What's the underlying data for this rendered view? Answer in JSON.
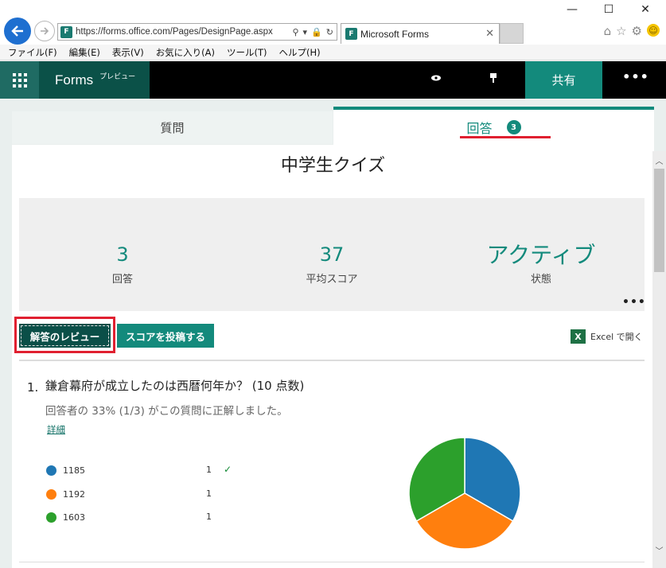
{
  "browser": {
    "url": "https://forms.office.com/Pages/DesignPage.aspx",
    "tab_title": "Microsoft Forms",
    "menu": [
      "ファイル(F)",
      "編集(E)",
      "表示(V)",
      "お気に入り(A)",
      "ツール(T)",
      "ヘルプ(H)"
    ]
  },
  "appbar": {
    "brand": "Forms",
    "preview": "プレビュー",
    "share": "共有",
    "more": "•••"
  },
  "tabs": {
    "questions": "質問",
    "responses": "回答",
    "responses_badge": "3"
  },
  "form": {
    "title": "中学生クイズ"
  },
  "stats": {
    "responses_value": "3",
    "responses_label": "回答",
    "avg_value": "37",
    "avg_label": "平均スコア",
    "status_value": "アクティブ",
    "status_label": "状態",
    "more": "•••"
  },
  "actions": {
    "review": "解答のレビュー",
    "post_scores": "スコアを投稿する",
    "excel_icon": "X",
    "open_excel": "Excel で開く"
  },
  "question": {
    "number": "1.",
    "text": "鎌倉幕府が成立したのは西暦何年か？ (10 点数)",
    "summary": "回答者の 33% (1/3) がこの質問に正解しました。",
    "details_link": "詳細",
    "options": [
      {
        "label": "1185",
        "count": "1",
        "color": "#1f77b4",
        "correct": true
      },
      {
        "label": "1192",
        "count": "1",
        "color": "#ff7f0e",
        "correct": false
      },
      {
        "label": "1603",
        "count": "1",
        "color": "#2ca02c",
        "correct": false
      }
    ],
    "correct_mark": "✓"
  },
  "chart_data": {
    "type": "pie",
    "categories": [
      "1185",
      "1192",
      "1603"
    ],
    "values": [
      1,
      1,
      1
    ],
    "colors": [
      "#1f77b4",
      "#ff7f0e",
      "#2ca02c"
    ]
  }
}
